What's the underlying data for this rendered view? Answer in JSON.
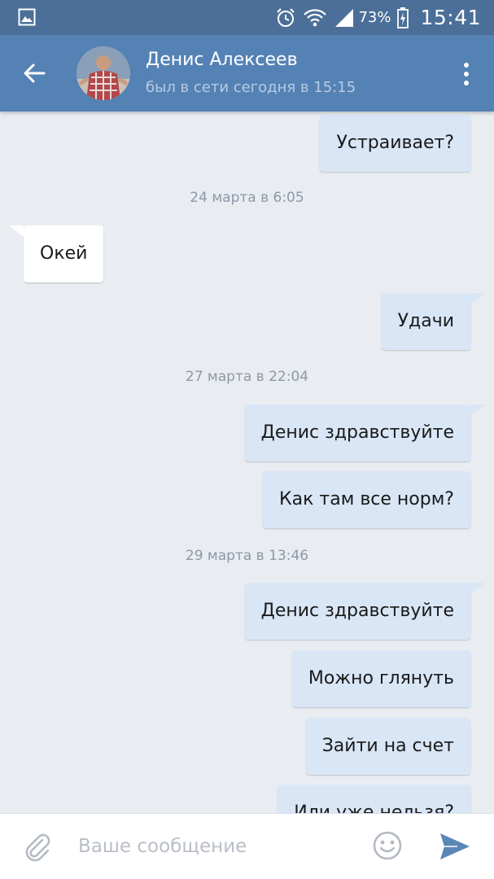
{
  "status_bar": {
    "battery": "73%",
    "time": "15:41",
    "icons": [
      "gallery-icon",
      "alarm-icon",
      "wifi-icon",
      "signal-icon",
      "battery-icon"
    ]
  },
  "header": {
    "name": "Денис Алексеев",
    "status": "был в сети сегодня в 15:15",
    "icons": [
      "back-arrow-icon",
      "avatar",
      "more-vertical-icon"
    ]
  },
  "messages": {
    "m1": "Устраивает?",
    "d1": "24 марта в 6:05",
    "m2": "Окей",
    "m3": "Удачи",
    "d2": "27 марта в 22:04",
    "m4": "Денис здравствуйте",
    "m5": "Как там все норм?",
    "d3": "29 марта в 13:46",
    "m6": "Денис здравствуйте",
    "m7": "Можно глянуть",
    "m8": "Зайти на счет",
    "m9": "Или уже нельзя?"
  },
  "composer": {
    "placeholder": "Ваше сообщение",
    "icons": [
      "paperclip-icon",
      "emoji-icon",
      "send-icon"
    ]
  },
  "colors": {
    "status_bar": "#4b6f98",
    "toolbar": "#5582b5",
    "background": "#e9edf2",
    "outgoing_bubble": "#d9e6f6",
    "incoming_bubble": "#ffffff",
    "send_icon": "#5b86b8"
  }
}
